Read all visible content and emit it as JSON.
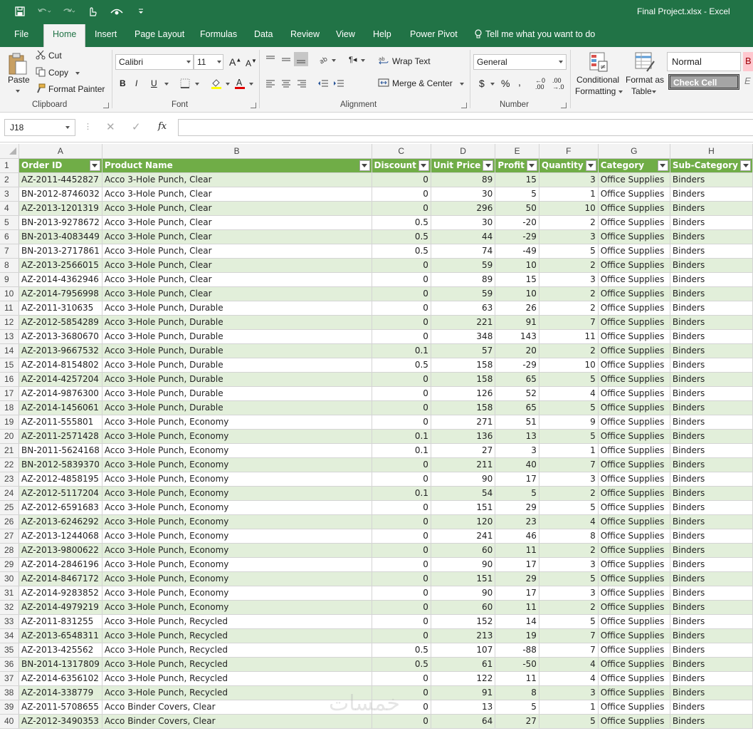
{
  "window": {
    "title": "Final Project.xlsx  -  Excel"
  },
  "tabs": [
    "File",
    "Home",
    "Insert",
    "Page Layout",
    "Formulas",
    "Data",
    "Review",
    "View",
    "Help",
    "Power Pivot"
  ],
  "active_tab": "Home",
  "tell_me": "Tell me what you want to do",
  "ribbon": {
    "clipboard": {
      "paste": "Paste",
      "cut": "Cut",
      "copy": "Copy",
      "format_painter": "Format Painter",
      "label": "Clipboard"
    },
    "font": {
      "name": "Calibri",
      "size": "11",
      "bold": "B",
      "italic": "I",
      "underline": "U",
      "label": "Font"
    },
    "alignment": {
      "wrap": "Wrap Text",
      "merge": "Merge & Center",
      "label": "Alignment"
    },
    "number": {
      "format": "General",
      "label": "Number"
    },
    "styles": {
      "conditional_1": "Conditional",
      "conditional_2": "Formatting",
      "format_table_1": "Format as",
      "format_table_2": "Table",
      "normal": "Normal",
      "check_cell": "Check Cell"
    }
  },
  "formula_bar": {
    "name_box": "J18",
    "fx": "fx",
    "content": ""
  },
  "column_letters": [
    "A",
    "B",
    "C",
    "D",
    "E",
    "F",
    "G",
    "H"
  ],
  "headers": [
    "Order ID",
    "Product Name",
    "Discount",
    "Unit Price",
    "Profit",
    "Quantity",
    "Category",
    "Sub-Category"
  ],
  "rows": [
    [
      "AZ-2011-4452827",
      "Acco 3-Hole Punch, Clear",
      "0",
      "89",
      "15",
      "3",
      "Office Supplies",
      "Binders"
    ],
    [
      "BN-2012-8746032",
      "Acco 3-Hole Punch, Clear",
      "0",
      "30",
      "5",
      "1",
      "Office Supplies",
      "Binders"
    ],
    [
      "AZ-2013-1201319",
      "Acco 3-Hole Punch, Clear",
      "0",
      "296",
      "50",
      "10",
      "Office Supplies",
      "Binders"
    ],
    [
      "BN-2013-9278672",
      "Acco 3-Hole Punch, Clear",
      "0.5",
      "30",
      "-20",
      "2",
      "Office Supplies",
      "Binders"
    ],
    [
      "BN-2013-4083449",
      "Acco 3-Hole Punch, Clear",
      "0.5",
      "44",
      "-29",
      "3",
      "Office Supplies",
      "Binders"
    ],
    [
      "BN-2013-2717861",
      "Acco 3-Hole Punch, Clear",
      "0.5",
      "74",
      "-49",
      "5",
      "Office Supplies",
      "Binders"
    ],
    [
      "AZ-2013-2566015",
      "Acco 3-Hole Punch, Clear",
      "0",
      "59",
      "10",
      "2",
      "Office Supplies",
      "Binders"
    ],
    [
      "AZ-2014-4362946",
      "Acco 3-Hole Punch, Clear",
      "0",
      "89",
      "15",
      "3",
      "Office Supplies",
      "Binders"
    ],
    [
      "AZ-2014-7956998",
      "Acco 3-Hole Punch, Clear",
      "0",
      "59",
      "10",
      "2",
      "Office Supplies",
      "Binders"
    ],
    [
      "AZ-2011-310635",
      "Acco 3-Hole Punch, Durable",
      "0",
      "63",
      "26",
      "2",
      "Office Supplies",
      "Binders"
    ],
    [
      "AZ-2012-5854289",
      "Acco 3-Hole Punch, Durable",
      "0",
      "221",
      "91",
      "7",
      "Office Supplies",
      "Binders"
    ],
    [
      "AZ-2013-3680670",
      "Acco 3-Hole Punch, Durable",
      "0",
      "348",
      "143",
      "11",
      "Office Supplies",
      "Binders"
    ],
    [
      "AZ-2013-9667532",
      "Acco 3-Hole Punch, Durable",
      "0.1",
      "57",
      "20",
      "2",
      "Office Supplies",
      "Binders"
    ],
    [
      "AZ-2014-8154802",
      "Acco 3-Hole Punch, Durable",
      "0.5",
      "158",
      "-29",
      "10",
      "Office Supplies",
      "Binders"
    ],
    [
      "AZ-2014-4257204",
      "Acco 3-Hole Punch, Durable",
      "0",
      "158",
      "65",
      "5",
      "Office Supplies",
      "Binders"
    ],
    [
      "AZ-2014-9876300",
      "Acco 3-Hole Punch, Durable",
      "0",
      "126",
      "52",
      "4",
      "Office Supplies",
      "Binders"
    ],
    [
      "AZ-2014-1456061",
      "Acco 3-Hole Punch, Durable",
      "0",
      "158",
      "65",
      "5",
      "Office Supplies",
      "Binders"
    ],
    [
      "AZ-2011-555801",
      "Acco 3-Hole Punch, Economy",
      "0",
      "271",
      "51",
      "9",
      "Office Supplies",
      "Binders"
    ],
    [
      "AZ-2011-2571428",
      "Acco 3-Hole Punch, Economy",
      "0.1",
      "136",
      "13",
      "5",
      "Office Supplies",
      "Binders"
    ],
    [
      "BN-2011-5624168",
      "Acco 3-Hole Punch, Economy",
      "0.1",
      "27",
      "3",
      "1",
      "Office Supplies",
      "Binders"
    ],
    [
      "BN-2012-5839370",
      "Acco 3-Hole Punch, Economy",
      "0",
      "211",
      "40",
      "7",
      "Office Supplies",
      "Binders"
    ],
    [
      "AZ-2012-4858195",
      "Acco 3-Hole Punch, Economy",
      "0",
      "90",
      "17",
      "3",
      "Office Supplies",
      "Binders"
    ],
    [
      "AZ-2012-5117204",
      "Acco 3-Hole Punch, Economy",
      "0.1",
      "54",
      "5",
      "2",
      "Office Supplies",
      "Binders"
    ],
    [
      "AZ-2012-6591683",
      "Acco 3-Hole Punch, Economy",
      "0",
      "151",
      "29",
      "5",
      "Office Supplies",
      "Binders"
    ],
    [
      "AZ-2013-6246292",
      "Acco 3-Hole Punch, Economy",
      "0",
      "120",
      "23",
      "4",
      "Office Supplies",
      "Binders"
    ],
    [
      "AZ-2013-1244068",
      "Acco 3-Hole Punch, Economy",
      "0",
      "241",
      "46",
      "8",
      "Office Supplies",
      "Binders"
    ],
    [
      "AZ-2013-9800622",
      "Acco 3-Hole Punch, Economy",
      "0",
      "60",
      "11",
      "2",
      "Office Supplies",
      "Binders"
    ],
    [
      "AZ-2014-2846196",
      "Acco 3-Hole Punch, Economy",
      "0",
      "90",
      "17",
      "3",
      "Office Supplies",
      "Binders"
    ],
    [
      "AZ-2014-8467172",
      "Acco 3-Hole Punch, Economy",
      "0",
      "151",
      "29",
      "5",
      "Office Supplies",
      "Binders"
    ],
    [
      "AZ-2014-9283852",
      "Acco 3-Hole Punch, Economy",
      "0",
      "90",
      "17",
      "3",
      "Office Supplies",
      "Binders"
    ],
    [
      "AZ-2014-4979219",
      "Acco 3-Hole Punch, Economy",
      "0",
      "60",
      "11",
      "2",
      "Office Supplies",
      "Binders"
    ],
    [
      "AZ-2011-831255",
      "Acco 3-Hole Punch, Recycled",
      "0",
      "152",
      "14",
      "5",
      "Office Supplies",
      "Binders"
    ],
    [
      "AZ-2013-6548311",
      "Acco 3-Hole Punch, Recycled",
      "0",
      "213",
      "19",
      "7",
      "Office Supplies",
      "Binders"
    ],
    [
      "AZ-2013-425562",
      "Acco 3-Hole Punch, Recycled",
      "0.5",
      "107",
      "-88",
      "7",
      "Office Supplies",
      "Binders"
    ],
    [
      "BN-2014-1317809",
      "Acco 3-Hole Punch, Recycled",
      "0.5",
      "61",
      "-50",
      "4",
      "Office Supplies",
      "Binders"
    ],
    [
      "AZ-2014-6356102",
      "Acco 3-Hole Punch, Recycled",
      "0",
      "122",
      "11",
      "4",
      "Office Supplies",
      "Binders"
    ],
    [
      "AZ-2014-338779",
      "Acco 3-Hole Punch, Recycled",
      "0",
      "91",
      "8",
      "3",
      "Office Supplies",
      "Binders"
    ],
    [
      "AZ-2011-5708655",
      "Acco Binder Covers, Clear",
      "0",
      "13",
      "5",
      "1",
      "Office Supplies",
      "Binders"
    ],
    [
      "AZ-2012-3490353",
      "Acco Binder Covers, Clear",
      "0",
      "64",
      "27",
      "5",
      "Office Supplies",
      "Binders"
    ]
  ],
  "watermark": "خمسات",
  "colors": {
    "excel_green": "#217346",
    "header_fill": "#70ad47",
    "band_fill": "#e2efda"
  }
}
